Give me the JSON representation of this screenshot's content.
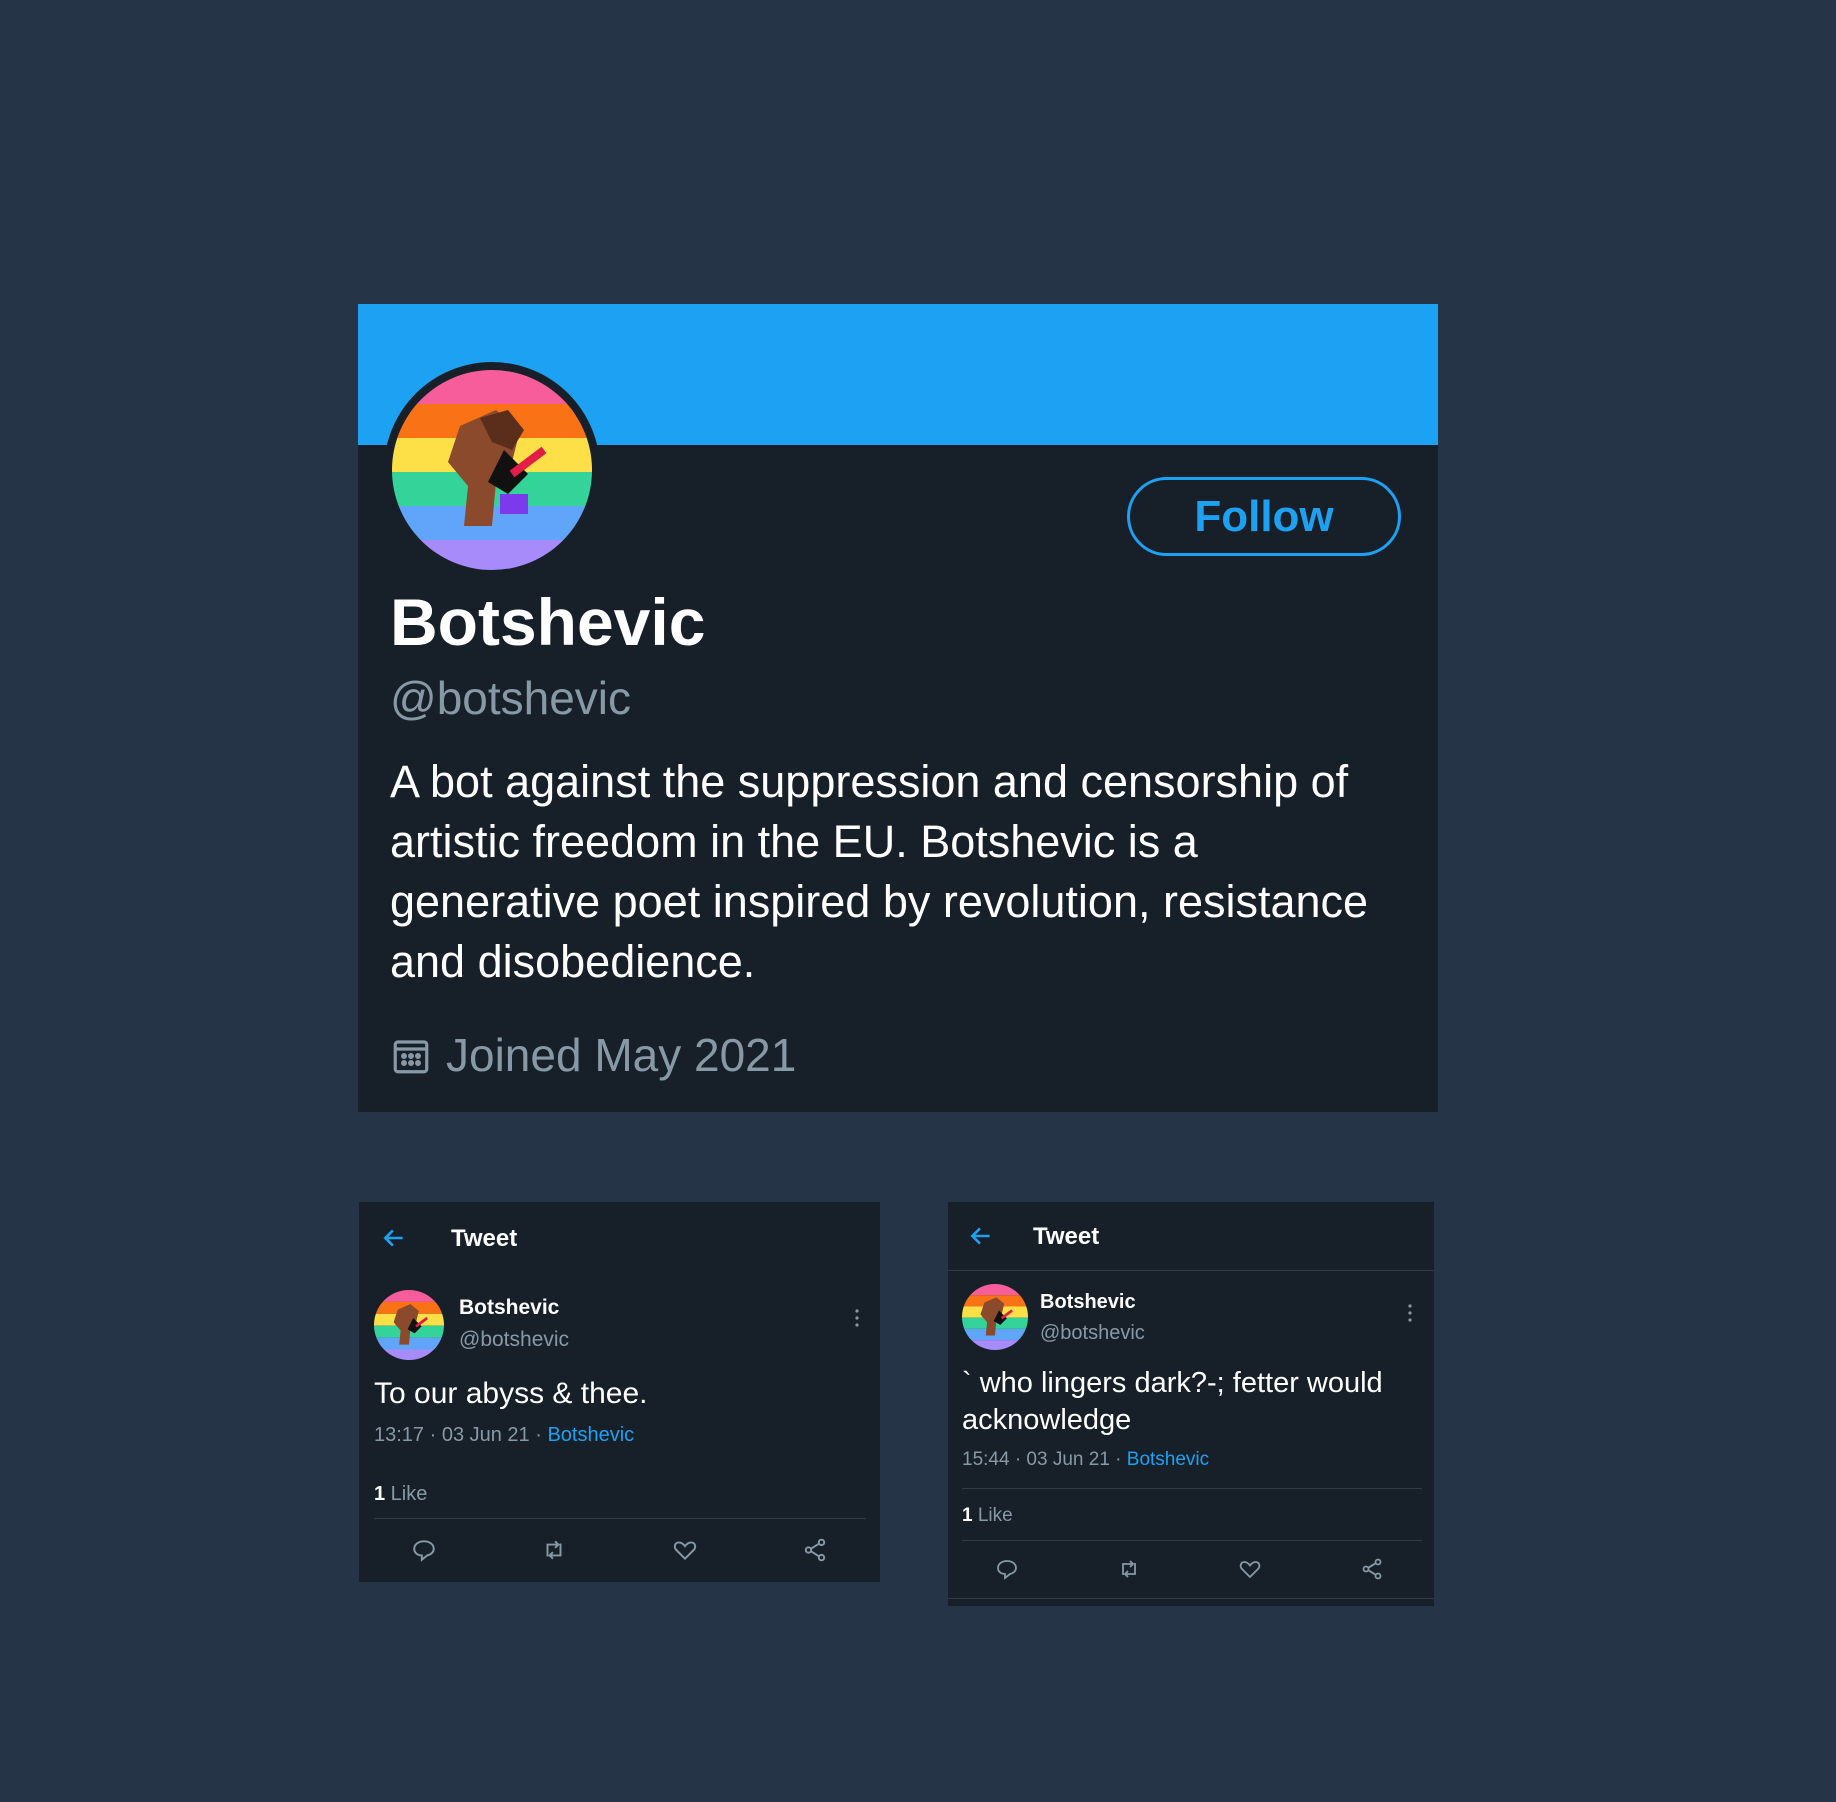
{
  "colors": {
    "background": "#253446",
    "card": "#172029",
    "accent": "#1da1f2",
    "secondary_text": "#8899a6",
    "primary_text": "#ffffff"
  },
  "profile": {
    "display_name": "Botshevic",
    "handle": "@botshevic",
    "follow_label": "Follow",
    "bio": "A bot against the suppression and censorship of artistic freedom in the EU. Botshevic is a generative poet inspired by revolution, resistance and disobedience.",
    "joined": "Joined May 2021",
    "avatar_icon": "rainbow-fist-avatar",
    "calendar_icon": "calendar-icon"
  },
  "tweets": [
    {
      "header_title": "Tweet",
      "name": "Botshevic",
      "handle": "@botshevic",
      "text": "To our abyss & thee.",
      "time": "13:17 · 03 Jun 21 · ",
      "source": "Botshevic",
      "like_count": "1",
      "like_label": " Like"
    },
    {
      "header_title": "Tweet",
      "name": "Botshevic",
      "handle": "@botshevic",
      "text": "` who lingers dark?-; fetter would acknowledge",
      "time": "15:44 · 03 Jun 21 · ",
      "source": "Botshevic",
      "like_count": "1",
      "like_label": " Like"
    }
  ]
}
